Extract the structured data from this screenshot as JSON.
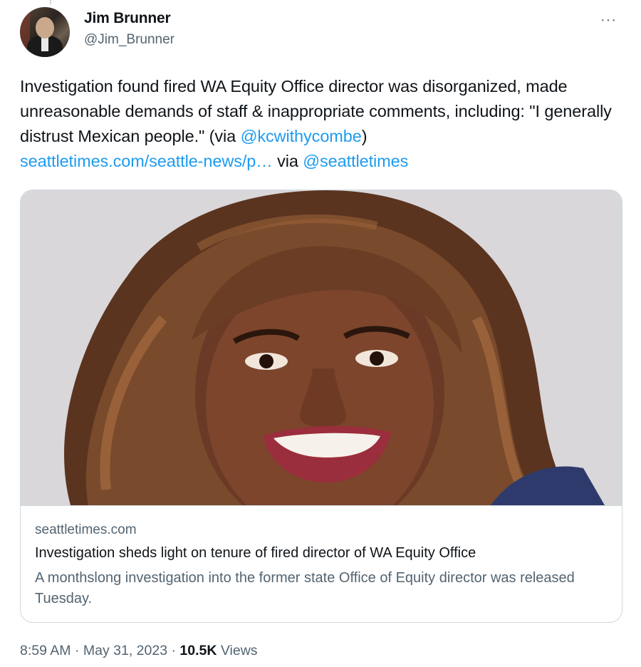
{
  "author": {
    "name": "Jim Brunner",
    "handle": "@Jim_Brunner",
    "avatar_icon": "avatar-photo"
  },
  "menu": {
    "more_label": "···"
  },
  "tweet": {
    "text_part1": "Investigation found fired WA Equity Office director was disorganized, made unreasonable demands of staff & inappropriate comments, including: \"I generally distrust Mexican people.\" (via ",
    "mention1": "@kcwithycombe",
    "text_part2": ")",
    "url": "seattletimes.com/seattle-news/p…",
    "text_part3": " via ",
    "mention2": "@seattletimes"
  },
  "card": {
    "domain": "seattletimes.com",
    "title": "Investigation sheds light on tenure of fired director of WA Equity Office",
    "description": "A monthslong investigation into the former state Office of Equity director was released Tuesday."
  },
  "meta": {
    "time": "8:59 AM",
    "separator": " · ",
    "date": "May 31, 2023",
    "views_count": "10.5K",
    "views_label": " Views"
  },
  "colors": {
    "link": "#1d9bf0",
    "text": "#0f1419",
    "secondary": "#536471",
    "border": "#cfd9de"
  }
}
